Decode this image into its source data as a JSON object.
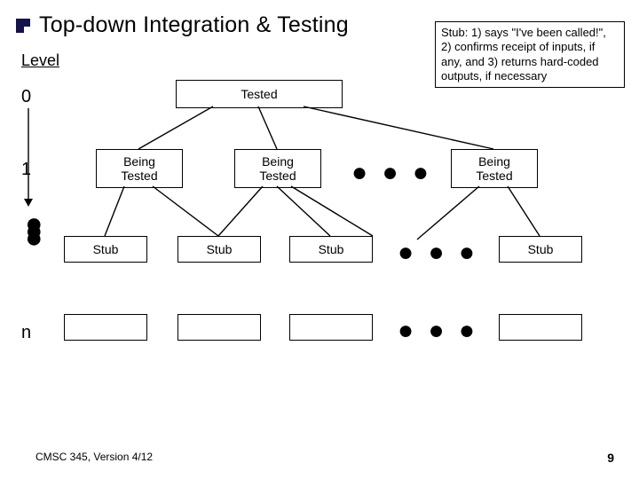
{
  "title": "Top-down Integration & Testing",
  "level_heading": "Level",
  "levels": {
    "l0": "0",
    "l1": "1",
    "ln": "n"
  },
  "callout": "Stub: 1) says \"I've been called!\", 2) confirms receipt of inputs, if any, and 3) returns hard-coded outputs, if necessary",
  "nodes": {
    "tested": "Tested",
    "being_tested": "Being\nTested",
    "stub": "Stub"
  },
  "ellipsis": "● ● ●",
  "footer": {
    "left": "CMSC 345, Version 4/12",
    "page": "9"
  }
}
